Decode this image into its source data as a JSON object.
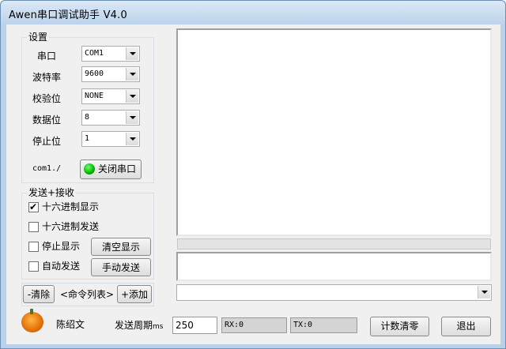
{
  "window": {
    "title": "Awen串口调试助手 V4.0"
  },
  "settings": {
    "title": "设置",
    "port_label": "串口",
    "port_value": "COM1",
    "baud_label": "波特率",
    "baud_value": "9600",
    "parity_label": "校验位",
    "parity_value": "NONE",
    "databits_label": "数据位",
    "databits_value": "8",
    "stopbits_label": "停止位",
    "stopbits_value": "1",
    "status_text": "com1./",
    "close_port_label": "关闭串口"
  },
  "sendrecv": {
    "title": "发送+接收",
    "hex_display_label": "十六进制显示",
    "hex_display_checked": true,
    "hex_send_label": "十六进制发送",
    "stop_display_label": "停止显示",
    "auto_send_label": "自动发送",
    "clear_display_label": "清空显示",
    "manual_send_label": "手动发送"
  },
  "cmdlist": {
    "clear_label": "-清除",
    "list_label": "<命令列表>",
    "add_label": "+添加"
  },
  "footer": {
    "author": "陈绍文",
    "period_label": "发送周期",
    "period_unit": "ms",
    "period_value": "250",
    "rx": "RX:0",
    "tx": "TX:0",
    "reset_count_label": "计数清零",
    "exit_label": "退出"
  },
  "colors": {
    "led": "#00b400",
    "titlebar": "#bcd3ec",
    "frame": "#b9d1ea"
  },
  "icons": {
    "status_led": "green-led-icon",
    "logo": "pumpkin-icon"
  }
}
